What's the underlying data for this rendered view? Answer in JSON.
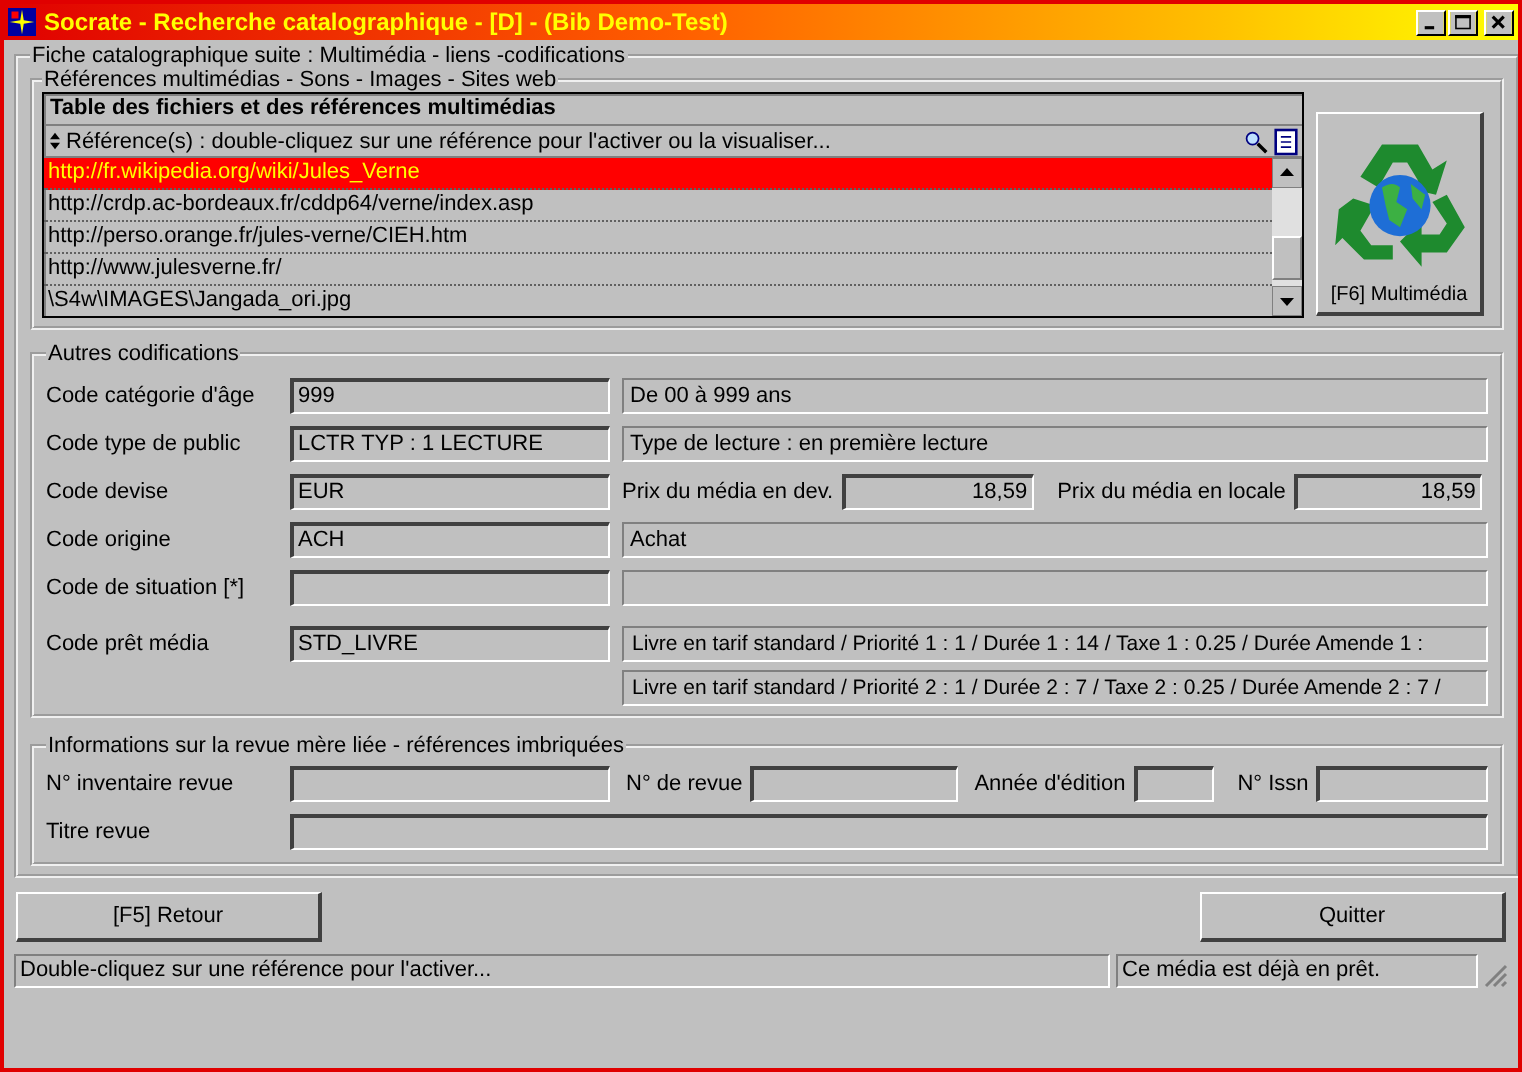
{
  "window": {
    "title": "Socrate - Recherche catalographique - [D] - (Bib Demo-Test)"
  },
  "main_group": {
    "label": "Fiche catalographique suite : Multimédia - liens -codifications"
  },
  "multimedia": {
    "label": "Références multimédias - Sons - Images - Sites web",
    "table_title": "Table des fichiers et des références multimédias",
    "header": "Référence(s) : double-cliquez sur une référence pour l'activer ou la visualiser...",
    "rows": [
      {
        "text": "http://fr.wikipedia.org/wiki/Jules_Verne",
        "selected": true
      },
      {
        "text": "http://crdp.ac-bordeaux.fr/cddp64/verne/index.asp",
        "selected": false
      },
      {
        "text": "http://perso.orange.fr/jules-verne/CIEH.htm",
        "selected": false
      },
      {
        "text": "http://www.julesverne.fr/",
        "selected": false
      },
      {
        "text": "\\S4w\\IMAGES\\Jangada_ori.jpg",
        "selected": false
      }
    ],
    "button": "[F6] Multimédia"
  },
  "codifications": {
    "label": "Autres codifications",
    "rows": [
      {
        "kind": "desc",
        "label": "Code catégorie d'âge",
        "code": "999",
        "description": "De 00 à 999 ans"
      },
      {
        "kind": "desc",
        "label": "Code type de public",
        "code": "LCTR TYP : 1 LECTURE",
        "description": "Type de lecture : en première lecture"
      },
      {
        "kind": "prices",
        "label": "Code devise",
        "code": "EUR",
        "price_dev_label": "Prix du média en dev.",
        "price_dev": "18,59",
        "price_local_label": "Prix du média en locale",
        "price_local": "18,59"
      },
      {
        "kind": "desc",
        "label": "Code origine",
        "code": "ACH",
        "description": "Achat"
      },
      {
        "kind": "desc",
        "label": "Code de situation [*]"
      },
      {
        "kind": "loan",
        "label": "Code prêt média",
        "code": "STD_LIVRE",
        "lines": [
          "Livre en tarif standard / Priorité 1 : 1 / Durée 1 : 14 / Taxe 1 : 0.25 / Durée Amende 1 :",
          "Livre en tarif standard / Priorité 2 : 1 / Durée 2 : 7 / Taxe 2 : 0.25 / Durée Amende 2 : 7 /"
        ]
      }
    ]
  },
  "revue": {
    "label": "Informations sur la revue mère liée - références imbriquées",
    "inventory_label": "N° inventaire revue",
    "number_label": "N° de revue",
    "year_label": "Année d'édition",
    "issn_label": "N° Issn",
    "title_label": "Titre revue"
  },
  "buttons": {
    "back": "[F5] Retour",
    "quit": "Quitter"
  },
  "status_bar": [
    "Double-cliquez sur une référence pour l'activer...",
    "Ce média est déjà en prêt."
  ]
}
